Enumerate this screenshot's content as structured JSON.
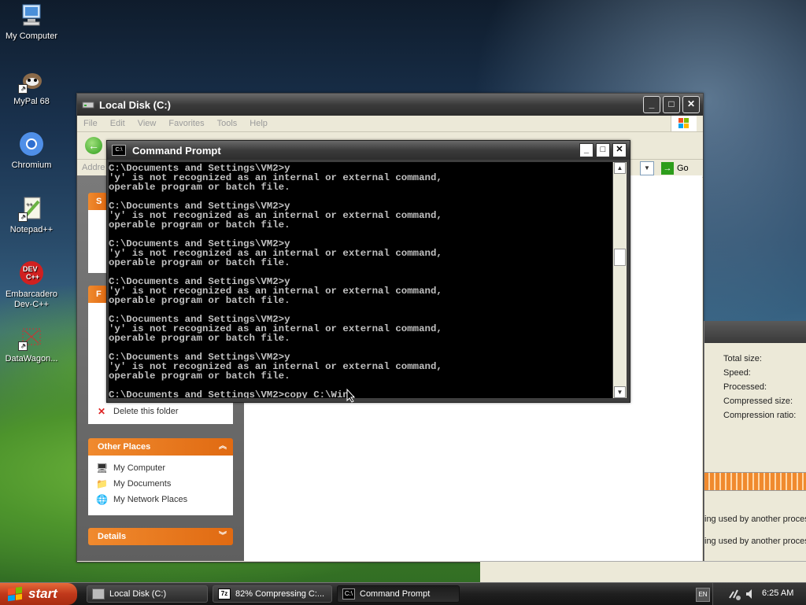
{
  "desktop": {
    "icons": [
      {
        "label": "My Computer"
      },
      {
        "label": "MyPal 68"
      },
      {
        "label": "Chromium"
      },
      {
        "label": "Notepad++"
      },
      {
        "label": "Embarcadero Dev-C++"
      },
      {
        "label": "DataWagon..."
      }
    ]
  },
  "explorer": {
    "title": "Local Disk (C:)",
    "menu": [
      "File",
      "Edit",
      "View",
      "Favorites",
      "Tools",
      "Help"
    ],
    "address_label": "Addre",
    "go_label": "Go",
    "tasks_partial": [
      "Delete this folder"
    ],
    "other_places": {
      "title": "Other Places",
      "items": [
        "My Computer",
        "My Documents",
        "My Network Places"
      ]
    },
    "details": {
      "title": "Details"
    }
  },
  "cmd": {
    "title": "Command Prompt",
    "lines": [
      "C:\\Documents and Settings\\VM2>y",
      "'y' is not recognized as an internal or external command,",
      "operable program or batch file.",
      "",
      "C:\\Documents and Settings\\VM2>y",
      "'y' is not recognized as an internal or external command,",
      "operable program or batch file.",
      "",
      "C:\\Documents and Settings\\VM2>y",
      "'y' is not recognized as an internal or external command,",
      "operable program or batch file.",
      "",
      "C:\\Documents and Settings\\VM2>y",
      "'y' is not recognized as an internal or external command,",
      "operable program or batch file.",
      "",
      "C:\\Documents and Settings\\VM2>y",
      "'y' is not recognized as an internal or external command,",
      "operable program or batch file.",
      "",
      "C:\\Documents and Settings\\VM2>y",
      "'y' is not recognized as an internal or external command,",
      "operable program or batch file.",
      ""
    ],
    "current_input": "C:\\Documents and Settings\\VM2>copy C:\\Win"
  },
  "zip_window": {
    "stats": [
      "Total size:",
      "Speed:",
      "Processed:",
      "Compressed size:",
      "Compression ratio:"
    ],
    "messages": [
      "ing used by another process",
      "ing used by another process"
    ]
  },
  "taskbar": {
    "start_label": "start",
    "buttons": [
      {
        "label": "Local Disk (C:)"
      },
      {
        "label": "82% Compressing C:..."
      },
      {
        "label": "Command Prompt"
      }
    ],
    "lang": "EN",
    "clock": "6:25 AM"
  }
}
